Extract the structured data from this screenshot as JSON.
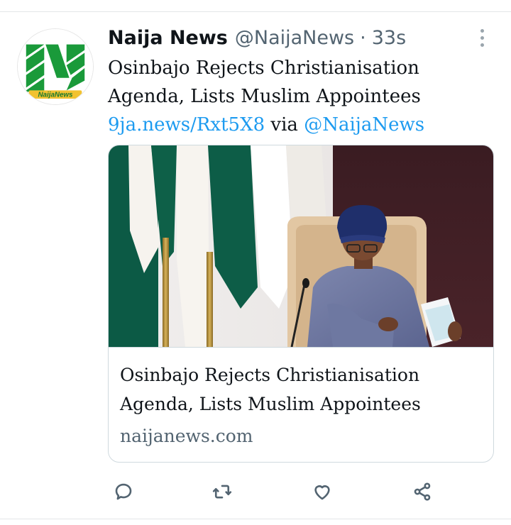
{
  "tweet": {
    "display_name": "Naija News",
    "handle": "@NaijaNews",
    "separator": "·",
    "time": "33s",
    "text_line1": "Osinbajo Rejects Christianisation",
    "text_line2": "Agenda, Lists Muslim Appointees",
    "link": "9ja.news/Rxt5X8",
    "via": "via",
    "mention": "@NaijaNews"
  },
  "avatar": {
    "logo_text": "NaijaNews",
    "brand_color": "#1a9a3a"
  },
  "card": {
    "title_line1": "Osinbajo Rejects Christianisation",
    "title_line2": "Agenda, Lists Muslim Appointees",
    "domain": "naijanews.com"
  },
  "actions": {
    "reply_icon": "reply-icon",
    "retweet_icon": "retweet-icon",
    "like_icon": "heart-icon",
    "share_icon": "share-icon"
  },
  "colors": {
    "link": "#1d9bf0",
    "muted": "#536471"
  }
}
